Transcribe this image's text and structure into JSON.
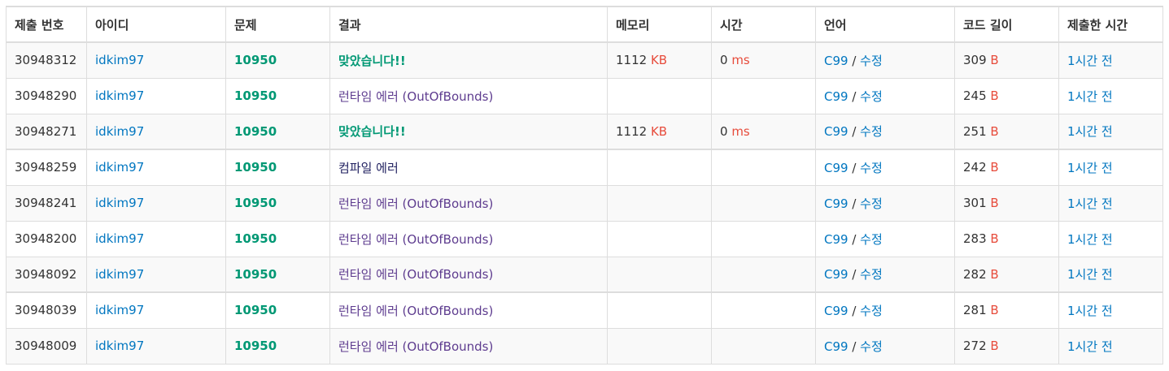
{
  "headers": [
    "제출 번호",
    "아이디",
    "문제",
    "결과",
    "메모리",
    "시간",
    "언어",
    "코드 길이",
    "제출한 시간"
  ],
  "units": {
    "memory": "KB",
    "time": "ms",
    "length": "B"
  },
  "colors": {
    "link": "#0076c0",
    "accepted": "#009874",
    "runtime_error": "#5e3c8f",
    "compile_error": "#1f1f5f",
    "unit": "#e74c3c",
    "border": "#dddddd",
    "stripe": "#f9f9f9"
  },
  "rows": [
    {
      "id": "30948312",
      "user": "idkim97",
      "problem": "10950",
      "result": "맞았습니다!!",
      "result_type": "ac",
      "memory": "1112",
      "time": "0",
      "lang": "C99",
      "edit": "수정",
      "length": "309",
      "submitted": "1시간 전",
      "group_start": false
    },
    {
      "id": "30948290",
      "user": "idkim97",
      "problem": "10950",
      "result": "런타임 에러 (OutOfBounds)",
      "result_type": "rte",
      "memory": "",
      "time": "",
      "lang": "C99",
      "edit": "수정",
      "length": "245",
      "submitted": "1시간 전",
      "group_start": false
    },
    {
      "id": "30948271",
      "user": "idkim97",
      "problem": "10950",
      "result": "맞았습니다!!",
      "result_type": "ac",
      "memory": "1112",
      "time": "0",
      "lang": "C99",
      "edit": "수정",
      "length": "251",
      "submitted": "1시간 전",
      "group_start": false
    },
    {
      "id": "30948259",
      "user": "idkim97",
      "problem": "10950",
      "result": "컴파일 에러",
      "result_type": "ce",
      "memory": "",
      "time": "",
      "lang": "C99",
      "edit": "수정",
      "length": "242",
      "submitted": "1시간 전",
      "group_start": true
    },
    {
      "id": "30948241",
      "user": "idkim97",
      "problem": "10950",
      "result": "런타임 에러 (OutOfBounds)",
      "result_type": "rte",
      "memory": "",
      "time": "",
      "lang": "C99",
      "edit": "수정",
      "length": "301",
      "submitted": "1시간 전",
      "group_start": false
    },
    {
      "id": "30948200",
      "user": "idkim97",
      "problem": "10950",
      "result": "런타임 에러 (OutOfBounds)",
      "result_type": "rte",
      "memory": "",
      "time": "",
      "lang": "C99",
      "edit": "수정",
      "length": "283",
      "submitted": "1시간 전",
      "group_start": false
    },
    {
      "id": "30948092",
      "user": "idkim97",
      "problem": "10950",
      "result": "런타임 에러 (OutOfBounds)",
      "result_type": "rte",
      "memory": "",
      "time": "",
      "lang": "C99",
      "edit": "수정",
      "length": "282",
      "submitted": "1시간 전",
      "group_start": false
    },
    {
      "id": "30948039",
      "user": "idkim97",
      "problem": "10950",
      "result": "런타임 에러 (OutOfBounds)",
      "result_type": "rte",
      "memory": "",
      "time": "",
      "lang": "C99",
      "edit": "수정",
      "length": "281",
      "submitted": "1시간 전",
      "group_start": true
    },
    {
      "id": "30948009",
      "user": "idkim97",
      "problem": "10950",
      "result": "런타임 에러 (OutOfBounds)",
      "result_type": "rte",
      "memory": "",
      "time": "",
      "lang": "C99",
      "edit": "수정",
      "length": "272",
      "submitted": "1시간 전",
      "group_start": false
    }
  ]
}
